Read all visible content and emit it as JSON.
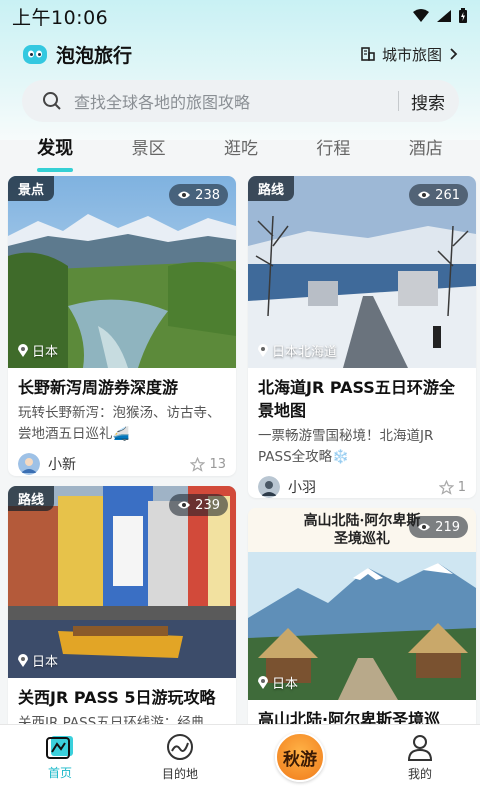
{
  "status_bar": {
    "time": "上午10:06"
  },
  "header": {
    "app_title": "泡泡旅行",
    "city_map_label": "城市旅图",
    "logo_icon": "bubble-logo-icon"
  },
  "search": {
    "placeholder": "查找全球各地的旅图攻略",
    "button_label": "搜索"
  },
  "tabs": [
    {
      "label": "发现",
      "active": true
    },
    {
      "label": "景区",
      "active": false
    },
    {
      "label": "逛吃",
      "active": false
    },
    {
      "label": "行程",
      "active": false
    },
    {
      "label": "酒店",
      "active": false
    }
  ],
  "cards": [
    {
      "tag": "景点",
      "views": "238",
      "location": "日本",
      "title": "长野新泻周游券深度游",
      "desc": "玩转长野新泻：泡猴汤、访古寺、尝地酒五日巡礼🚄",
      "author": "小新",
      "likes": "13"
    },
    {
      "tag": "路线",
      "views": "261",
      "location": "日本北海道",
      "title": "北海道JR PASS五日环游全景地图",
      "desc": "一票畅游雪国秘境！北海道JR PASS全攻略❄️",
      "author": "小羽",
      "likes": "1"
    },
    {
      "tag": "路线",
      "views": "239",
      "location": "日本",
      "title": "关西JR PASS 5日游玩攻略",
      "desc": "关西JR PASS五日环线游：经典"
    },
    {
      "views": "219",
      "location": "日本",
      "image_caption_line1": "高山北陆·阿尔卑斯",
      "image_caption_line2": "圣境巡礼",
      "title": "高山北陆·阿尔卑斯圣境巡"
    }
  ],
  "bottom_nav": [
    {
      "label": "首页",
      "active": true
    },
    {
      "label": "目的地",
      "active": false
    },
    {
      "label": "秋游",
      "active": false
    },
    {
      "label": "我的",
      "active": false
    }
  ],
  "colors": {
    "accent": "#35d0d4",
    "nav_active": "#1bb9c9",
    "tag_bg": "#1e2a36"
  }
}
